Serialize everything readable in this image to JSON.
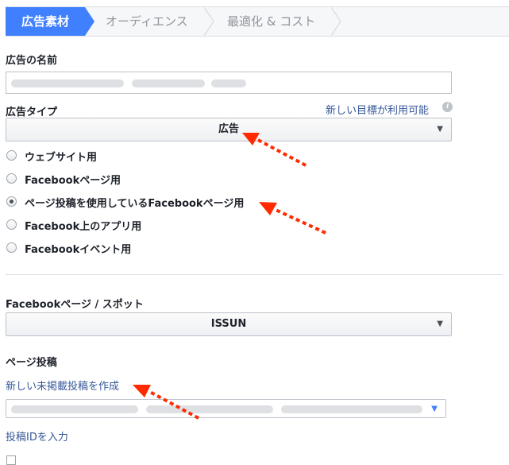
{
  "steps": [
    {
      "label": "広告素材"
    },
    {
      "label": "オーディエンス"
    },
    {
      "label": "最適化 & コスト"
    }
  ],
  "ad_name": {
    "label": "広告の名前",
    "value": ""
  },
  "ad_type": {
    "label": "広告タイプ",
    "new_goal_link": "新しい目標が利用可能",
    "selected": "広告",
    "options": [
      {
        "label": "ウェブサイト用",
        "checked": false
      },
      {
        "label": "Facebookページ用",
        "checked": false
      },
      {
        "label": "ページ投稿を使用しているFacebookページ用",
        "checked": true
      },
      {
        "label": "Facebook上のアプリ用",
        "checked": false
      },
      {
        "label": "Facebookイベント用",
        "checked": false
      }
    ]
  },
  "page_spot": {
    "label": "Facebookページ / スポット",
    "selected": "ISSUN"
  },
  "page_post": {
    "label": "ページ投稿",
    "create_link": "新しい未掲載投稿を作成",
    "enter_id_link": "投稿IDを入力"
  },
  "colors": {
    "accent": "#4080ff",
    "link": "#365899",
    "annotation_arrow": "#ff2a00"
  },
  "icons": [
    "info-icon",
    "caret-down-icon",
    "annotation-arrow"
  ]
}
